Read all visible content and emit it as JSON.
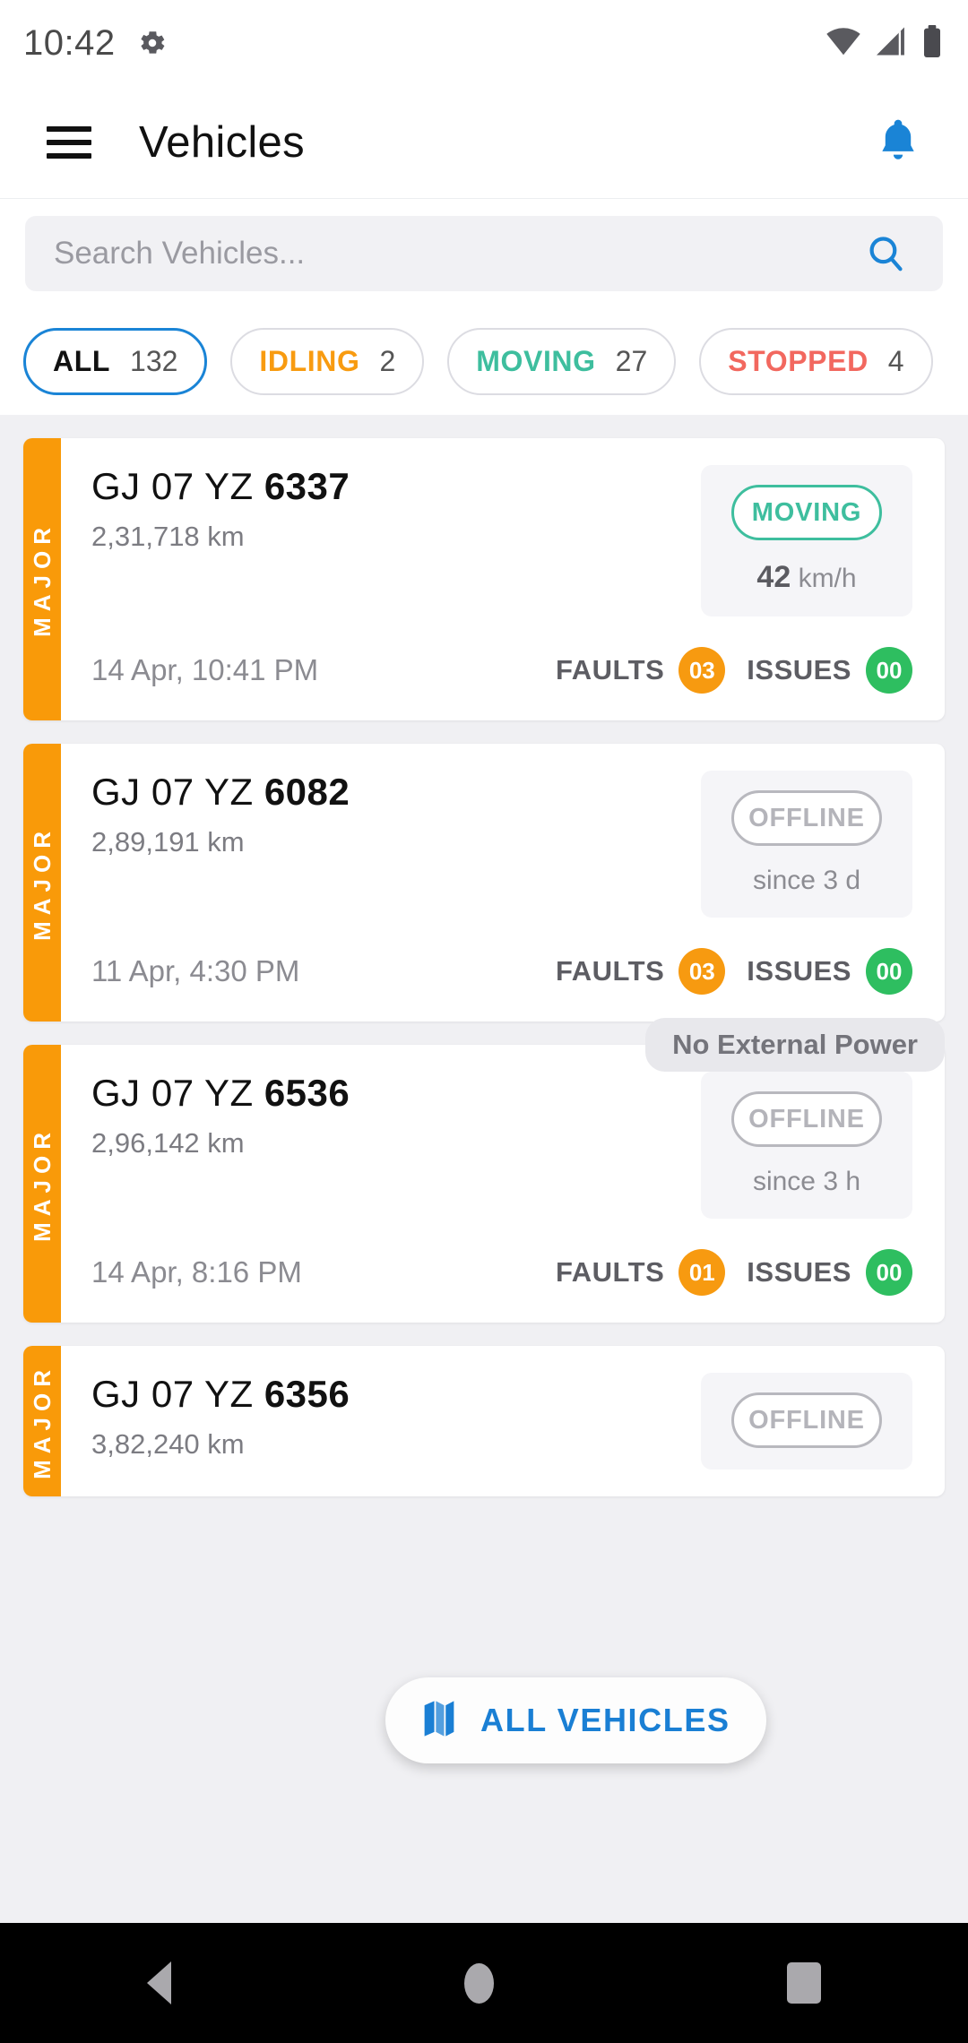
{
  "status_bar": {
    "time": "10:42",
    "icons": [
      "gear-icon",
      "wifi-icon",
      "cellular-signal-icon",
      "battery-icon"
    ]
  },
  "app_bar": {
    "title": "Vehicles",
    "menu_icon": "hamburger-menu-icon",
    "notification_icon": "bell-icon",
    "notification_color": "#1a84d6"
  },
  "search": {
    "placeholder": "Search Vehicles...",
    "value": "",
    "icon": "search-icon",
    "icon_color": "#1a84d6"
  },
  "filters": [
    {
      "label": "ALL",
      "count": "132",
      "color": "#111111",
      "selected": true
    },
    {
      "label": "IDLING",
      "count": "2",
      "color": "#F89B10",
      "selected": false
    },
    {
      "label": "MOVING",
      "count": "27",
      "color": "#3EBE9E",
      "selected": false
    },
    {
      "label": "STOPPED",
      "count": "4",
      "color": "#F2685F",
      "selected": false
    }
  ],
  "vehicles": [
    {
      "severity": "MAJOR",
      "severity_color": "#F99A09",
      "plate_prefix": "GJ 07 YZ ",
      "plate_number": "6337",
      "odometer": "2,31,718 km",
      "status": "MOVING",
      "status_color": "#3EBE9E",
      "speed_value": "42",
      "speed_unit": " km/h",
      "timestamp": "14 Apr, 10:41 PM",
      "faults_label": "FAULTS",
      "faults_count": "03",
      "issues_label": "ISSUES",
      "issues_count": "00",
      "power_tag": ""
    },
    {
      "severity": "MAJOR",
      "severity_color": "#F99A09",
      "plate_prefix": "GJ 07 YZ ",
      "plate_number": "6082",
      "odometer": "2,89,191 km",
      "status": "OFFLINE",
      "status_color": "#b4b4ba",
      "speed_value": "",
      "speed_unit": "since 3 d",
      "timestamp": "11 Apr, 4:30 PM",
      "faults_label": "FAULTS",
      "faults_count": "03",
      "issues_label": "ISSUES",
      "issues_count": "00",
      "power_tag": ""
    },
    {
      "severity": "MAJOR",
      "severity_color": "#F99A09",
      "plate_prefix": "GJ 07 YZ ",
      "plate_number": "6536",
      "odometer": "2,96,142 km",
      "status": "OFFLINE",
      "status_color": "#b4b4ba",
      "speed_value": "",
      "speed_unit": "since 3 h",
      "timestamp": "14 Apr, 8:16 PM",
      "faults_label": "FAULTS",
      "faults_count": "01",
      "issues_label": "ISSUES",
      "issues_count": "00",
      "power_tag": "No External Power"
    },
    {
      "severity": "MAJOR",
      "severity_color": "#F99A09",
      "plate_prefix": "GJ 07 YZ ",
      "plate_number": "6356",
      "odometer": "3,82,240 km",
      "status": "OFFLINE",
      "status_color": "#b4b4ba",
      "speed_value": "",
      "speed_unit": "",
      "timestamp": "",
      "faults_label": "",
      "faults_count": "",
      "issues_label": "",
      "issues_count": "",
      "power_tag": ""
    }
  ],
  "fab": {
    "label": "ALL VEHICLES",
    "icon": "map-icon",
    "color": "#1a7fd4"
  },
  "nav_bar": {
    "back": "back-triangle-icon",
    "home": "home-circle-icon",
    "recents": "recents-square-icon"
  }
}
